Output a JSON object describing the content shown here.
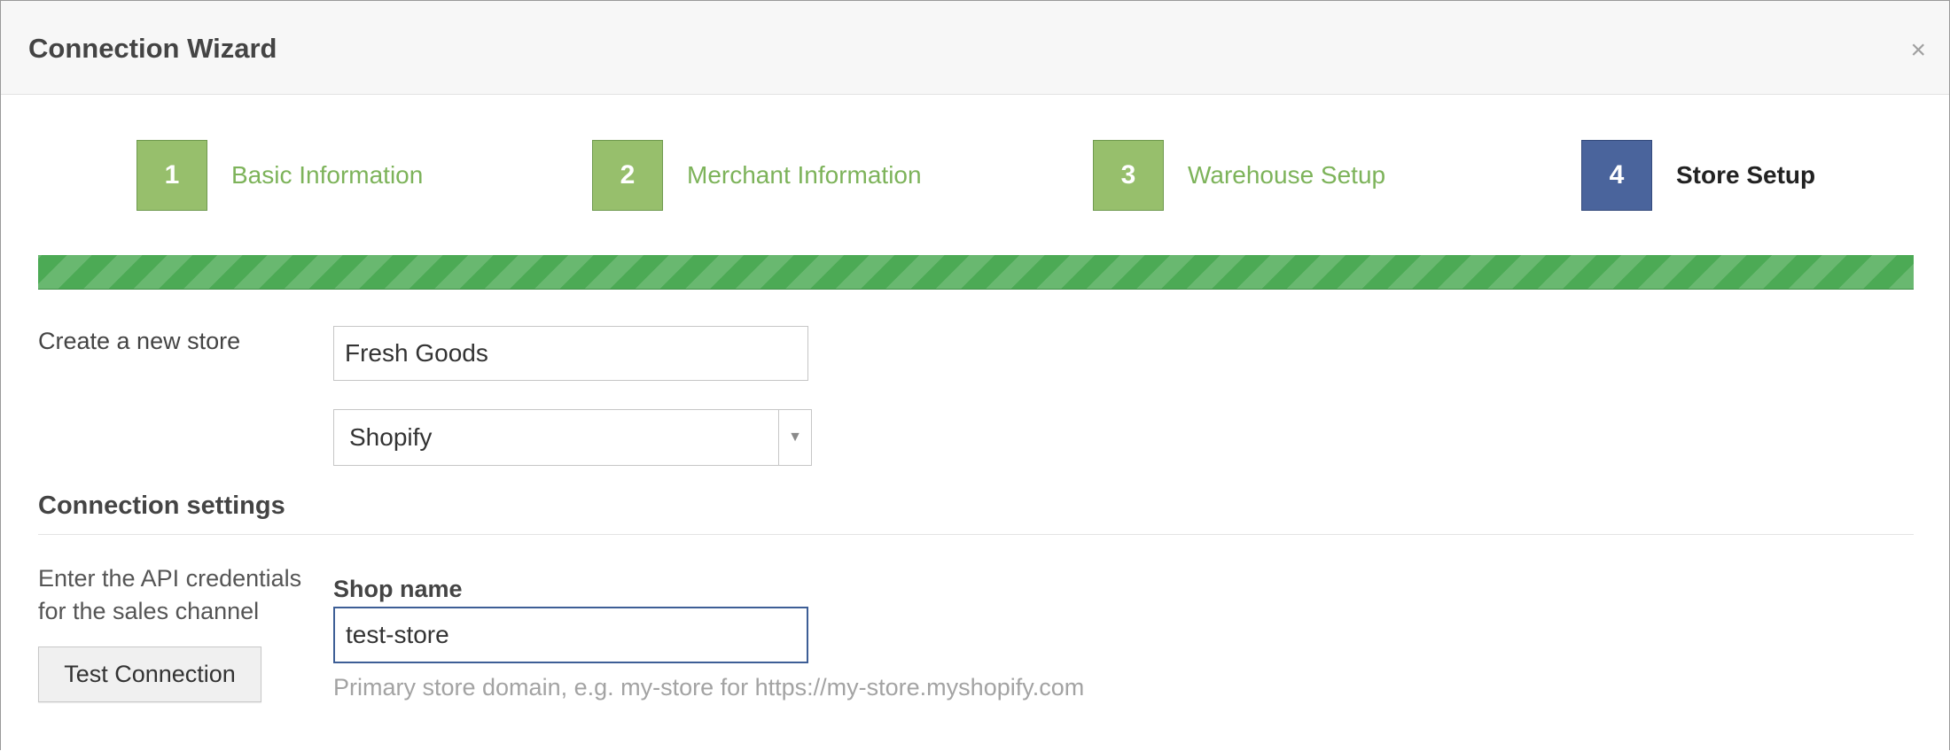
{
  "modal": {
    "title": "Connection Wizard",
    "close_icon": "×"
  },
  "steps": [
    {
      "number": "1",
      "label": "Basic Information",
      "state": "completed"
    },
    {
      "number": "2",
      "label": "Merchant Information",
      "state": "completed"
    },
    {
      "number": "3",
      "label": "Warehouse Setup",
      "state": "completed"
    },
    {
      "number": "4",
      "label": "Store Setup",
      "state": "active"
    }
  ],
  "progress": {
    "value_percent": 100,
    "color": "#4caa55"
  },
  "store": {
    "label": "Create a new store",
    "name_value": "Fresh Goods",
    "platform_value": "Shopify",
    "dropdown_icon": "▼"
  },
  "connection": {
    "heading": "Connection settings",
    "help_text": "Enter the API credentials for the sales channel",
    "test_button_label": "Test Connection",
    "shop_name_label": "Shop name",
    "shop_name_value": "test-store",
    "shop_name_hint": "Primary store domain, e.g. my-store for https://my-store.myshopify.com"
  },
  "colors": {
    "step_completed": "#97bf6c",
    "step_active": "#4a649c",
    "step_completed_text": "#7db35a"
  }
}
